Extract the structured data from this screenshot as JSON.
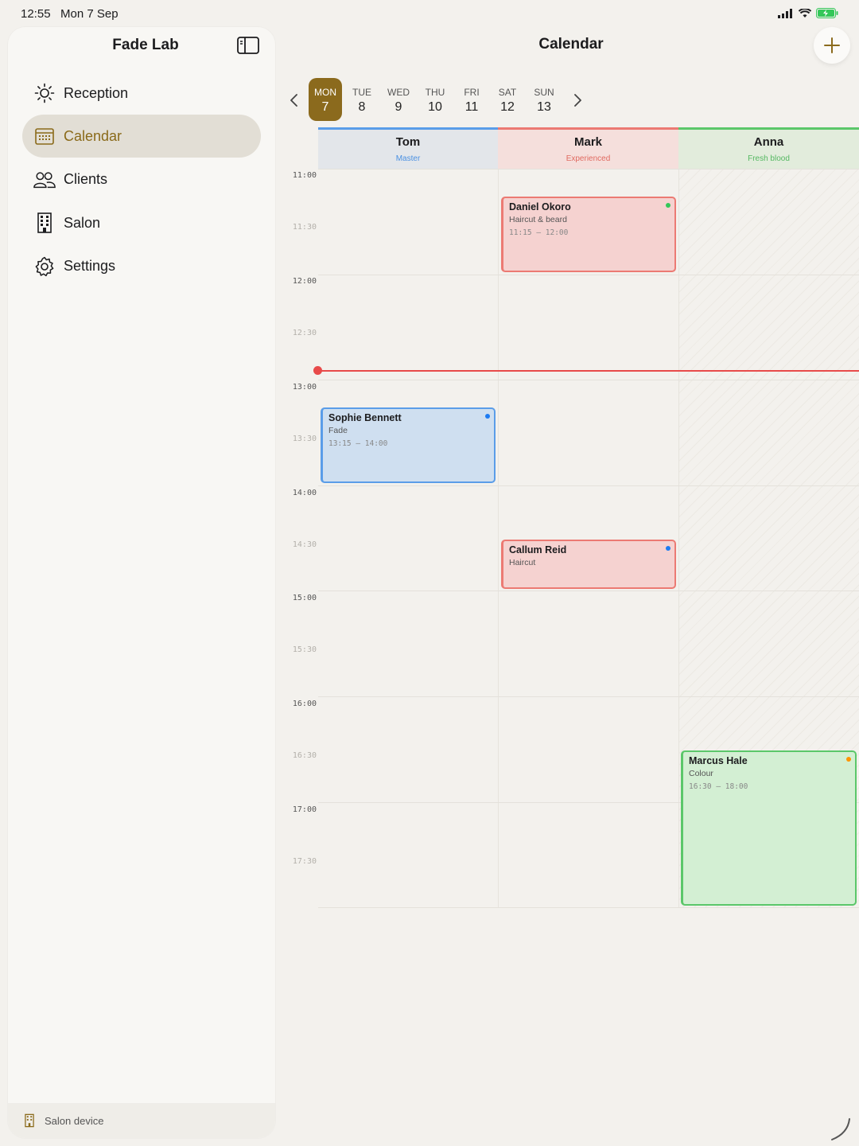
{
  "status": {
    "time": "12:55",
    "date": "Mon 7 Sep"
  },
  "sidebar": {
    "title": "Fade Lab",
    "items": [
      {
        "label": "Reception",
        "icon": "sun-icon"
      },
      {
        "label": "Calendar",
        "icon": "calendar-icon",
        "active": true
      },
      {
        "label": "Clients",
        "icon": "people-icon"
      },
      {
        "label": "Salon",
        "icon": "building-icon"
      },
      {
        "label": "Settings",
        "icon": "gear-icon"
      }
    ],
    "footer": "Salon device"
  },
  "main": {
    "title": "Calendar",
    "week": [
      {
        "dow": "MON",
        "num": "7",
        "active": true
      },
      {
        "dow": "TUE",
        "num": "8"
      },
      {
        "dow": "WED",
        "num": "9"
      },
      {
        "dow": "THU",
        "num": "10"
      },
      {
        "dow": "FRI",
        "num": "11"
      },
      {
        "dow": "SAT",
        "num": "12"
      },
      {
        "dow": "SUN",
        "num": "13"
      }
    ],
    "staff": [
      {
        "name": "Tom",
        "role": "Master"
      },
      {
        "name": "Mark",
        "role": "Experienced"
      },
      {
        "name": "Anna",
        "role": "Fresh blood"
      }
    ],
    "times": [
      "11:00",
      "11:30",
      "12:00",
      "12:30",
      "13:00",
      "13:30",
      "14:00",
      "14:30",
      "15:00",
      "15:30",
      "16:00",
      "16:30",
      "17:00",
      "17:30"
    ],
    "appointments": [
      {
        "client": "Daniel Okoro",
        "service": "Haircut & beard",
        "time": "11:15 – 12:00"
      },
      {
        "client": "Sophie Bennett",
        "service": "Fade",
        "time": "13:15 – 14:00"
      },
      {
        "client": "Callum Reid",
        "service": "Haircut",
        "time": ""
      },
      {
        "client": "Marcus Hale",
        "service": "Colour",
        "time": "16:30 – 18:00"
      }
    ]
  },
  "colors": {
    "accent": "#8b6a1d",
    "tom": "#5a9de8",
    "mark": "#ec7a73",
    "anna": "#5bc76a",
    "now": "#e84a4a"
  }
}
